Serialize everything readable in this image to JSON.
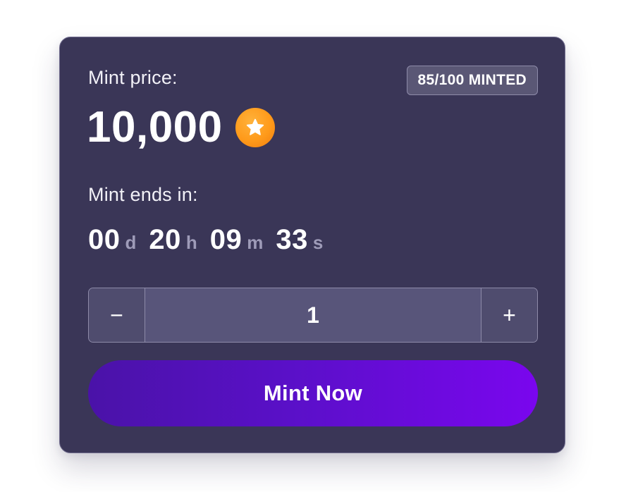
{
  "mint": {
    "price_label": "Mint price:",
    "price_value": "10,000",
    "currency_icon": "star-coin-icon",
    "minted_badge": "85/100 MINTED",
    "ends_label": "Mint ends in:",
    "countdown": {
      "days": "00",
      "days_unit": "d",
      "hours": "20",
      "hours_unit": "h",
      "minutes": "09",
      "minutes_unit": "m",
      "seconds": "33",
      "seconds_unit": "s"
    },
    "quantity": {
      "minus_label": "−",
      "value": "1",
      "plus_label": "+"
    },
    "button_label": "Mint Now"
  },
  "colors": {
    "card_bg": "#3a3657",
    "coin": "#ff9a1a",
    "button_gradient_start": "#4a12a8",
    "button_gradient_end": "#7a06ee",
    "unit_text": "#9e9bb8"
  }
}
